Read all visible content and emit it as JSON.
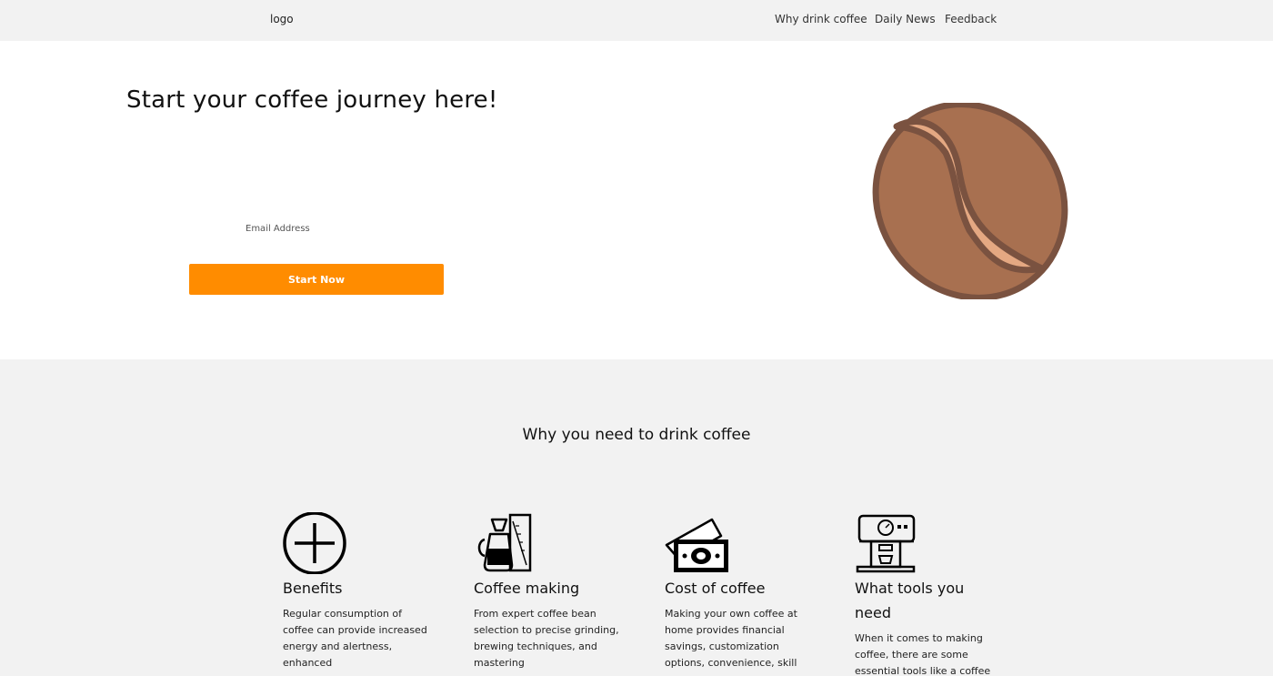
{
  "header": {
    "logo": "logo",
    "nav": [
      "Why drink coffee",
      "Daily News",
      "Feedback"
    ]
  },
  "hero": {
    "title": "Start your coffee journey here!",
    "email_placeholder": "Email Address",
    "button_label": "Start Now",
    "image": "coffee-bean-illustration"
  },
  "why": {
    "title": "Why you need to drink coffee",
    "cards": [
      {
        "icon": "plus-circle-icon",
        "title": "Benefits",
        "text": "Regular consumption of coffee can provide increased energy and alertness, enhanced"
      },
      {
        "icon": "coffee-maker-icon",
        "title": "Coffee making",
        "text": "From expert coffee bean selection to precise grinding, brewing techniques, and mastering"
      },
      {
        "icon": "money-icon",
        "title": "Cost of coffee",
        "text": "Making your own coffee at home provides financial savings, customization options, convenience, skill"
      },
      {
        "icon": "espresso-machine-icon",
        "title": "What tools you need",
        "text": "When it comes to making coffee, there are some essential tools like a coffee"
      }
    ]
  },
  "colors": {
    "accent": "#ff8c00",
    "bean_outline": "#7a5240",
    "bean_fill": "#a87050",
    "bean_crease": "#e4a882",
    "section_bg": "#f2f2f2"
  }
}
